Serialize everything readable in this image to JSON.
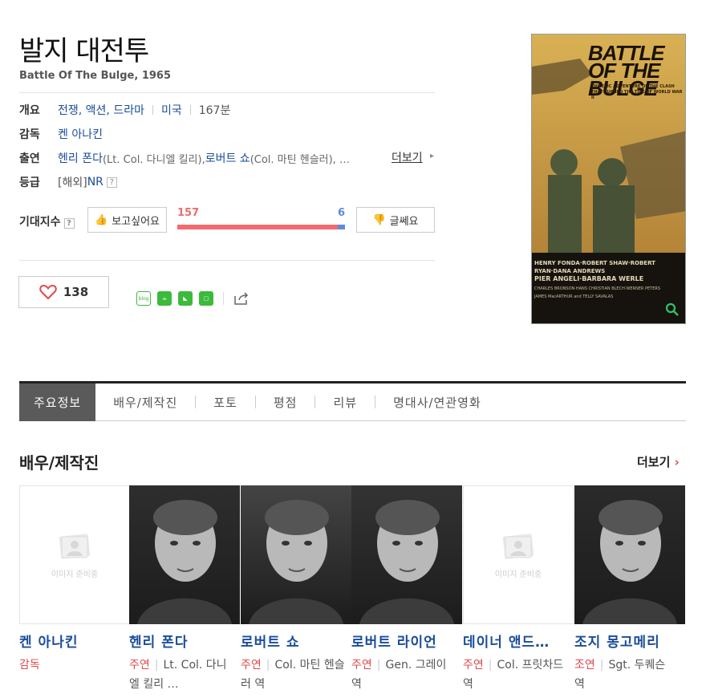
{
  "movie": {
    "title_ko": "발지 대전투",
    "title_en": "Battle Of The Bulge, 1965"
  },
  "info": {
    "overview_label": "개요",
    "genres": "전쟁, 액션, 드라마",
    "country": "미국",
    "runtime": "167분",
    "director_label": "감독",
    "director": "켄 아나킨",
    "cast_label": "출연",
    "cast_1_name": "헨리 폰다",
    "cast_1_role": "(Lt. Col. 다니엘 킬리), ",
    "cast_2_name": "로버트 쇼",
    "cast_2_role": "(Col. 마틴 헨슬러), …",
    "more": "더보기",
    "rating_label": "등급",
    "rating_prefix": "[해외]",
    "rating_value": "NR"
  },
  "expectation": {
    "label": "기대지수",
    "want_button": "보고싶어요",
    "no_button": "글쎄요",
    "want_count": "157",
    "no_count": "6"
  },
  "like": {
    "count": "138"
  },
  "tabs": [
    "주요정보",
    "배우/제작진",
    "포토",
    "평점",
    "리뷰",
    "명대사/연관영화"
  ],
  "cast_section": {
    "title": "배우/제작진",
    "more": "더보기"
  },
  "cast": [
    {
      "name": "켄 아나킨",
      "type": "감독",
      "role": "",
      "photo": "placeholder",
      "placeholder_text": "이미지 준비중"
    },
    {
      "name": "헨리 폰다",
      "type": "주연",
      "role": "Lt. Col. 다니엘 킬리 …",
      "photo": "portrait"
    },
    {
      "name": "로버트 쇼",
      "type": "주연",
      "role": "Col. 마틴 헨슬러 역",
      "photo": "portrait"
    },
    {
      "name": "로버트 라이언",
      "type": "주연",
      "role": "Gen. 그레이 역",
      "photo": "portrait"
    },
    {
      "name": "데이너 앤드…",
      "type": "주연",
      "role": "Col. 프릿차드 역",
      "photo": "placeholder",
      "placeholder_text": "이미지 준비중"
    },
    {
      "name": "조지 몽고메리",
      "type": "조연",
      "role": "Sgt. 두퀘슨 역",
      "photo": "portrait"
    }
  ],
  "poster": {
    "title_text": "BATTLE OF THE BULGE",
    "tagline": "THE EPIC ADVENTURE OF THE CLASH THAT TURNED THE TIDE OF WORLD WAR II",
    "credits_1": "HENRY FONDA·ROBERT SHAW·ROBERT RYAN·DANA ANDREWS",
    "credits_2": "PIER ANGELI·BARBARA WERLE",
    "credits_3": "CHARLES BRONSON·HANS CHRISTIAN BLECH·WERNER PETERS",
    "credits_4": "JAMES MacARTHUR and TELLY SAVALAS"
  }
}
